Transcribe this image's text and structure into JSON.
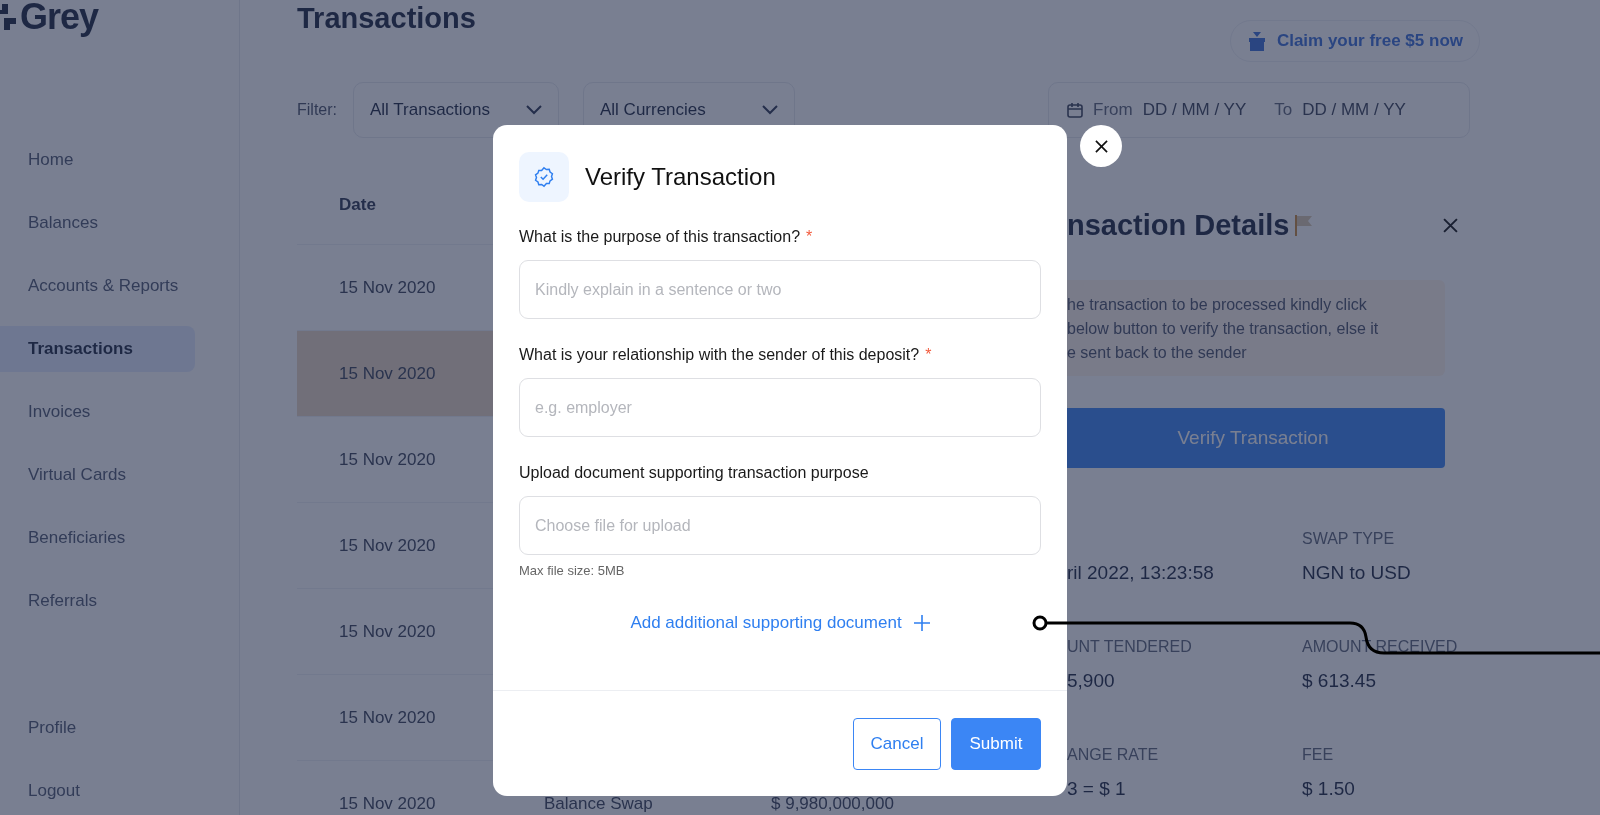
{
  "sidebar": {
    "logo": "Grey",
    "items": [
      {
        "label": "Home",
        "selected": false
      },
      {
        "label": "Balances",
        "selected": false
      },
      {
        "label": "Accounts & Reports",
        "selected": false
      },
      {
        "label": "Transactions",
        "selected": true
      },
      {
        "label": "Invoices",
        "selected": false
      },
      {
        "label": "Virtual Cards",
        "selected": false
      },
      {
        "label": "Beneficiaries",
        "selected": false
      },
      {
        "label": "Referrals",
        "selected": false
      }
    ],
    "bottom_items": [
      {
        "label": "Profile",
        "selected": false
      },
      {
        "label": "Logout",
        "selected": false
      }
    ]
  },
  "header": {
    "title": "Transactions",
    "promo": "Claim your free $5 now"
  },
  "filters": {
    "label": "Filter:",
    "dropdowns": [
      "All Transactions",
      "All Currencies"
    ],
    "date_range": {
      "from_label": "From",
      "from_placeholder": "DD / MM / YY",
      "to_label": "To",
      "to_placeholder": "DD / MM / YY"
    }
  },
  "table": {
    "columns": [
      "Date"
    ],
    "rows": [
      {
        "cells": [
          "15 Nov 2020"
        ],
        "selected": false
      },
      {
        "cells": [
          "15 Nov 2020"
        ],
        "selected": true
      },
      {
        "cells": [
          "15 Nov 2020"
        ],
        "selected": false
      },
      {
        "cells": [
          "15 Nov 2020"
        ],
        "selected": false
      },
      {
        "cells": [
          "15 Nov 2020"
        ],
        "selected": false
      },
      {
        "cells": [
          "15 Nov 2020"
        ],
        "selected": false
      },
      {
        "cells": [
          "15 Nov 2020",
          "Balance Swap",
          "$ 9,980,000,000"
        ],
        "selected": false
      }
    ]
  },
  "details": {
    "title": "nsaction Details",
    "notice": [
      "he transaction to be processed kindly click",
      "below button to verify the transaction, else it",
      "e sent back to the sender"
    ],
    "button": "Verify Transaction",
    "field_rows": [
      {
        "fields": [
          {
            "value": "ril 2022, 13:23:58"
          },
          {
            "label": "SWAP TYPE",
            "value": "NGN to USD"
          }
        ]
      },
      {
        "fields": [
          {
            "label": "UNT TENDERED",
            "value": "5,900"
          },
          {
            "label": "AMOUNT RECEIVED",
            "value": "$ 613.45"
          }
        ]
      },
      {
        "fields": [
          {
            "label": "ANGE RATE",
            "value": "3 = $ 1"
          },
          {
            "label": "FEE",
            "value": "$ 1.50"
          }
        ]
      }
    ]
  },
  "modal": {
    "title": "Verify Transaction",
    "fields": [
      {
        "label": "What is the purpose of this transaction?",
        "required_mark": "*",
        "placeholder": "Kindly explain in a sentence or two"
      },
      {
        "label": "What is your relationship with the sender of this deposit?",
        "required_mark": "*",
        "placeholder": "e.g. employer"
      },
      {
        "label": "Upload document supporting transaction purpose",
        "placeholder": "Choose file for upload",
        "hint": "Max file size: 5MB"
      }
    ],
    "link": "Add additional supporting document",
    "buttons": [
      {
        "label": "Cancel",
        "kind": "secondary"
      },
      {
        "label": "Submit",
        "kind": "primary"
      }
    ]
  }
}
